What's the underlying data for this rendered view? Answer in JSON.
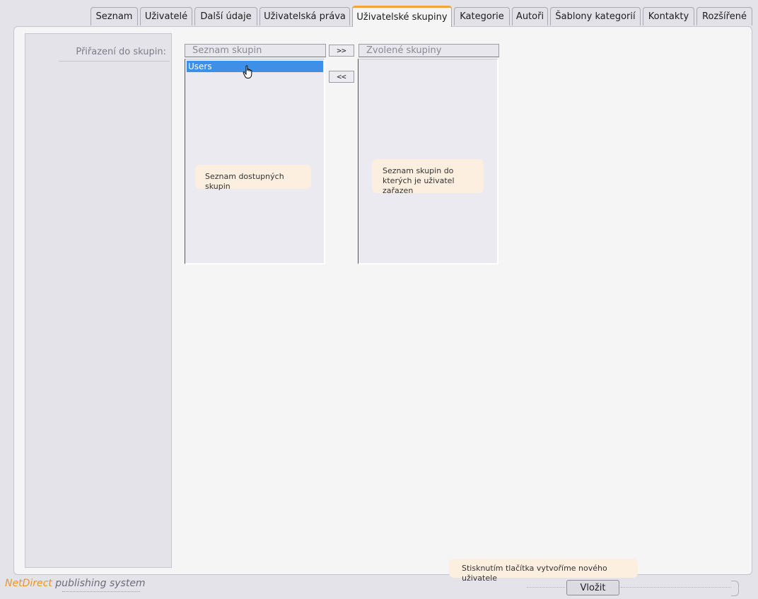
{
  "tabs": [
    {
      "label": "Seznam"
    },
    {
      "label": "Uživatelé"
    },
    {
      "label": "Další údaje"
    },
    {
      "label": "Uživatelská práva"
    },
    {
      "label": "Uživatelské skupiny"
    },
    {
      "label": "Kategorie"
    },
    {
      "label": "Autoři"
    },
    {
      "label": "Šablony kategorií"
    },
    {
      "label": "Kontakty"
    },
    {
      "label": "Rozšířené"
    }
  ],
  "active_tab": "Uživatelské skupiny",
  "form": {
    "assign_label": "Přiřazení do skupin:"
  },
  "available_list": {
    "header": "Seznam skupin",
    "items": [
      "Users"
    ],
    "tip": "Seznam dostupných skupin"
  },
  "selected_list": {
    "header": "Zvolené skupiny",
    "tip": "Seznam skupin do kterých je uživatel zařazen"
  },
  "move_buttons": {
    "add": ">>",
    "remove": "<<"
  },
  "footer": {
    "brand_primary": "NetDirect",
    "brand_secondary": "publishing system",
    "submit_tip": "Stisknutím tlačítka vytvoříme nového uživatele",
    "submit_label": "Vložit"
  },
  "colors": {
    "accent_tab": "#f0a63e",
    "selection": "#3d8fe7",
    "tooltip_bg": "#fcefe0"
  }
}
